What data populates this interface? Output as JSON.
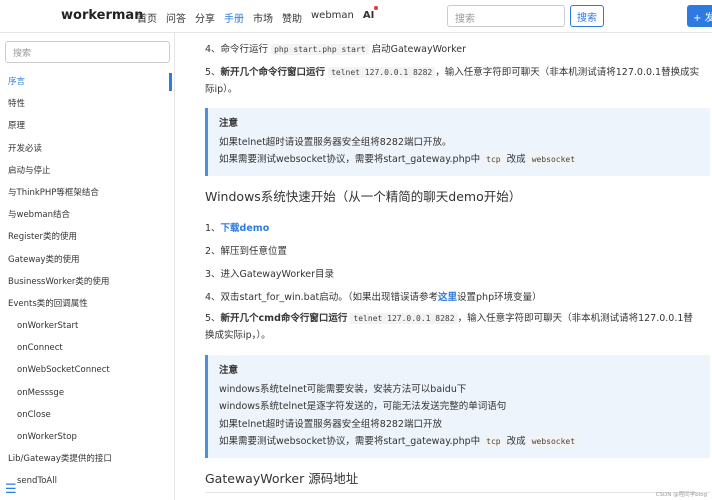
{
  "header": {
    "brand": "workerman",
    "nav": [
      "首页",
      "问答",
      "分享",
      "手册",
      "市场",
      "赞助",
      "webman",
      "AI"
    ],
    "search_placeholder": "搜索",
    "search_button": "搜索",
    "new_button": "+ 发"
  },
  "sidebar": {
    "search_placeholder": "搜索",
    "items": [
      "序言",
      "特性",
      "原理",
      "开发必读",
      "启动与停止",
      "与ThinkPHP等框架结合",
      "与webman结合",
      "Register类的使用",
      "Gateway类的使用",
      "BusinessWorker类的使用",
      "Events类的回调属性",
      "onWorkerStart",
      "onConnect",
      "onWebSocketConnect",
      "onMesssge",
      "onClose",
      "onWorkerStop",
      "Lib/Gateway类提供的接口",
      "sendToAll"
    ]
  },
  "main": {
    "step4_a": "4、命令行运行",
    "step4_code": "php start.php start",
    "step4_b": "启动GatewayWorker",
    "step5_num": "5、",
    "step5_strong": "新开几个命令行窗口运行",
    "step5_code": "telnet 127.0.0.1 8282",
    "step5_rest": "，输入任意字符即可聊天（非本机测试请将127.0.0.1替换成实际ip）。",
    "note1_title": "注意",
    "note1_line1": "如果telnet超时请设置服务器安全组将8282端口开放。",
    "note1_line2_a": "如果需要测试websocket协议，需要将start_gateway.php中",
    "note1_code1": "tcp",
    "note1_line2_b": "改成",
    "note1_code2": "websocket",
    "win_heading": "Windows系统快速开始（从一个精简的聊天demo开始）",
    "w1_num": "1、",
    "w1_link": "下载demo",
    "w2": "2、解压到任意位置",
    "w3": "3、进入GatewayWorker目录",
    "w4_a": "4、双击start_for_win.bat启动。（如果出现错误请参考",
    "w4_link": "这里",
    "w4_b": "设置php环境变量）",
    "w5_num": "5、",
    "w5_strong": "新开几个cmd命令行窗口运行",
    "w5_code": "telnet 127.0.0.1 8282",
    "w5_rest": "，输入任意字符即可聊天（非本机测试请将127.0.0.1替换成实际ip，）。",
    "note2_title": "注意",
    "note2_line1": "windows系统telnet可能需要安装，安装方法可以baidu下",
    "note2_line2": "windows系统telnet是逐字符发送的，可能无法发送完整的单词语句",
    "note2_line3": "如果telnet超时请设置服务器安全组将8282端口开放",
    "note2_line4_a": "如果需要测试websocket协议，需要将start_gateway.php中",
    "note2_code1": "tcp",
    "note2_line4_b": "改成",
    "note2_code2": "websocket",
    "src_heading": "GatewayWorker 源码地址"
  },
  "watermark": "CSDN @程同学blog"
}
